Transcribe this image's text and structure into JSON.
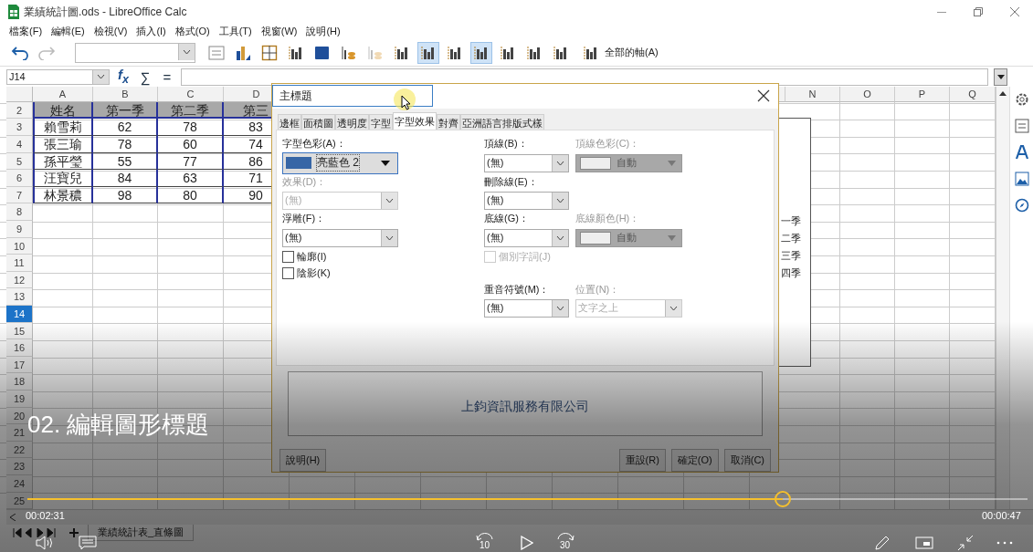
{
  "window": {
    "title": "業績統計圖.ods - LibreOffice Calc"
  },
  "menu": [
    "檔案(F)",
    "編輯(E)",
    "檢視(V)",
    "插入(I)",
    "格式(O)",
    "工具(T)",
    "視窗(W)",
    "說明(H)"
  ],
  "toolbar": {
    "items": [
      {
        "kind": "dialog",
        "selected": false,
        "disabled": false
      },
      {
        "kind": "chart-type",
        "selected": false,
        "disabled": false
      },
      {
        "kind": "grid",
        "selected": false,
        "disabled": false
      },
      {
        "kind": "bars",
        "selected": false,
        "disabled": false
      },
      {
        "kind": "cube",
        "selected": false,
        "disabled": false
      },
      {
        "kind": "data-table",
        "selected": false,
        "disabled": false
      },
      {
        "kind": "data-table",
        "selected": false,
        "disabled": true
      },
      {
        "kind": "bars",
        "selected": false,
        "disabled": false
      },
      {
        "kind": "bars",
        "selected": true,
        "disabled": false
      },
      {
        "kind": "bars",
        "selected": false,
        "disabled": false
      },
      {
        "kind": "bars",
        "selected": true,
        "disabled": false
      },
      {
        "kind": "bars",
        "selected": false,
        "disabled": false
      },
      {
        "kind": "bars",
        "selected": false,
        "disabled": false
      },
      {
        "kind": "bars",
        "selected": false,
        "disabled": false
      }
    ],
    "all_axes": "全部的軸(A)"
  },
  "formula_bar": {
    "cell_ref": "J14",
    "buttons": [
      "f$_{x}$",
      "∑",
      "="
    ]
  },
  "sheet": {
    "columns": [
      "A",
      "B",
      "C",
      "D",
      "N",
      "O",
      "P",
      "Q"
    ],
    "rows": [
      {
        "number": "2",
        "selected": false,
        "kind": "header",
        "cells": [
          "姓名",
          "第一季",
          "第二季",
          "第三"
        ]
      },
      {
        "number": "3",
        "selected": false,
        "kind": "data",
        "cells": [
          "賴雪莉",
          "62",
          "78",
          "83"
        ]
      },
      {
        "number": "4",
        "selected": false,
        "kind": "data",
        "cells": [
          "張三瑜",
          "78",
          "60",
          "74"
        ]
      },
      {
        "number": "5",
        "selected": false,
        "kind": "data",
        "cells": [
          "孫平瑩",
          "55",
          "77",
          "86"
        ]
      },
      {
        "number": "6",
        "selected": false,
        "kind": "data",
        "cells": [
          "汪寶兒",
          "84",
          "63",
          "71"
        ]
      },
      {
        "number": "7",
        "selected": false,
        "kind": "data",
        "cells": [
          "林景穠",
          "98",
          "80",
          "90"
        ]
      },
      {
        "number": "8",
        "selected": false,
        "kind": "empty"
      },
      {
        "number": "9",
        "selected": false,
        "kind": "empty"
      },
      {
        "number": "10",
        "selected": false,
        "kind": "empty"
      },
      {
        "number": "11",
        "selected": false,
        "kind": "empty"
      },
      {
        "number": "12",
        "selected": false,
        "kind": "empty"
      },
      {
        "number": "13",
        "selected": false,
        "kind": "empty"
      },
      {
        "number": "14",
        "selected": true,
        "kind": "empty"
      },
      {
        "number": "15",
        "selected": false,
        "kind": "empty"
      },
      {
        "number": "16",
        "selected": false,
        "kind": "empty"
      },
      {
        "number": "17",
        "selected": false,
        "kind": "empty"
      },
      {
        "number": "18",
        "selected": false,
        "kind": "empty"
      },
      {
        "number": "19",
        "selected": false,
        "kind": "empty"
      },
      {
        "number": "20",
        "selected": false,
        "kind": "empty"
      },
      {
        "number": "21",
        "selected": false,
        "kind": "empty"
      },
      {
        "number": "22",
        "selected": false,
        "kind": "empty"
      },
      {
        "number": "23",
        "selected": false,
        "kind": "empty"
      },
      {
        "number": "24",
        "selected": false,
        "kind": "empty"
      },
      {
        "number": "25",
        "selected": false,
        "kind": "empty"
      }
    ],
    "chart_legend": [
      "一季",
      "二季",
      "三季",
      "四季"
    ],
    "sheet_tabs": [
      {
        "label": "業績統計表_直條圖",
        "selected": true
      }
    ]
  },
  "dialog": {
    "title": "主標題",
    "tabs": [
      {
        "label": "邊框",
        "selected": false
      },
      {
        "label": "面積圖",
        "selected": false
      },
      {
        "label": "透明度",
        "selected": false
      },
      {
        "label": "字型",
        "selected": false
      },
      {
        "label": "字型效果",
        "selected": true
      },
      {
        "label": "對齊",
        "selected": false
      },
      {
        "label": "亞洲語言排版式樣",
        "selected": false
      }
    ],
    "font_color": {
      "label": "字型色彩(A)：",
      "value": "亮藍色 2"
    },
    "effects": {
      "label": "效果(D)：",
      "value": "(無)",
      "disabled": true
    },
    "relief": {
      "label": "浮雕(F)：",
      "value": "(無)",
      "disabled": false
    },
    "outline": {
      "label": "輪廓(I)",
      "checked": false
    },
    "shadow": {
      "label": "陰影(K)",
      "checked": false
    },
    "overline": {
      "label": "頂線(B)：",
      "value": "(無)",
      "disabled": false
    },
    "overline_color": {
      "label": "頂線色彩(C)：",
      "value": "自動",
      "disabled": true
    },
    "strikethrough": {
      "label": "刪除線(E)：",
      "value": "(無)",
      "disabled": false
    },
    "underline": {
      "label": "底線(G)：",
      "value": "(無)",
      "disabled": false
    },
    "underline_color": {
      "label": "底線顏色(H)：",
      "value": "自動",
      "disabled": true
    },
    "individual_words": {
      "label": "個別字詞(J)",
      "checked": false,
      "disabled": true
    },
    "emphasis_mark": {
      "label": "重音符號(M)：",
      "value": "(無)",
      "disabled": false
    },
    "position": {
      "label": "位置(N)：",
      "value": "文字之上",
      "disabled": true
    },
    "preview": "上鈞資訊服務有限公司",
    "help_button": "說明(H)",
    "buttons": [
      "重設(R)",
      "確定(O)",
      "取消(C)"
    ]
  },
  "video_player": {
    "caption": "02. 編輯圖形標題",
    "elapsed": "00:02:31",
    "remaining": "00:00:47",
    "level": 0.755,
    "rewind": "10",
    "forward": "30"
  }
}
